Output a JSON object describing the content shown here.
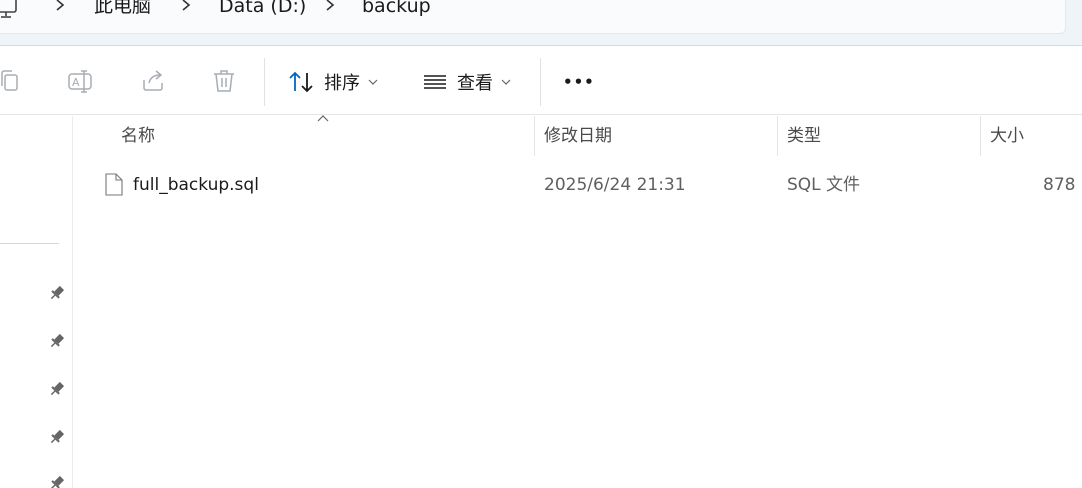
{
  "breadcrumb": {
    "items": [
      "此电脑",
      "Data (D:)",
      "backup"
    ]
  },
  "toolbar": {
    "icons": [
      "copy-icon",
      "rename-icon",
      "share-icon",
      "delete-icon"
    ],
    "sort_label": "排序",
    "view_label": "查看",
    "more_label": "•••"
  },
  "columns": {
    "name": "名称",
    "modified": "修改日期",
    "type": "类型",
    "size": "大小"
  },
  "files": [
    {
      "name": "full_backup.sql",
      "modified": "2025/6/24 21:31",
      "type": "SQL 文件",
      "size": "878"
    }
  ],
  "colors": {
    "accent": "#0067c0",
    "address_bar_bg": "#eff4f9",
    "icon_gray": "#9aa0a6"
  }
}
